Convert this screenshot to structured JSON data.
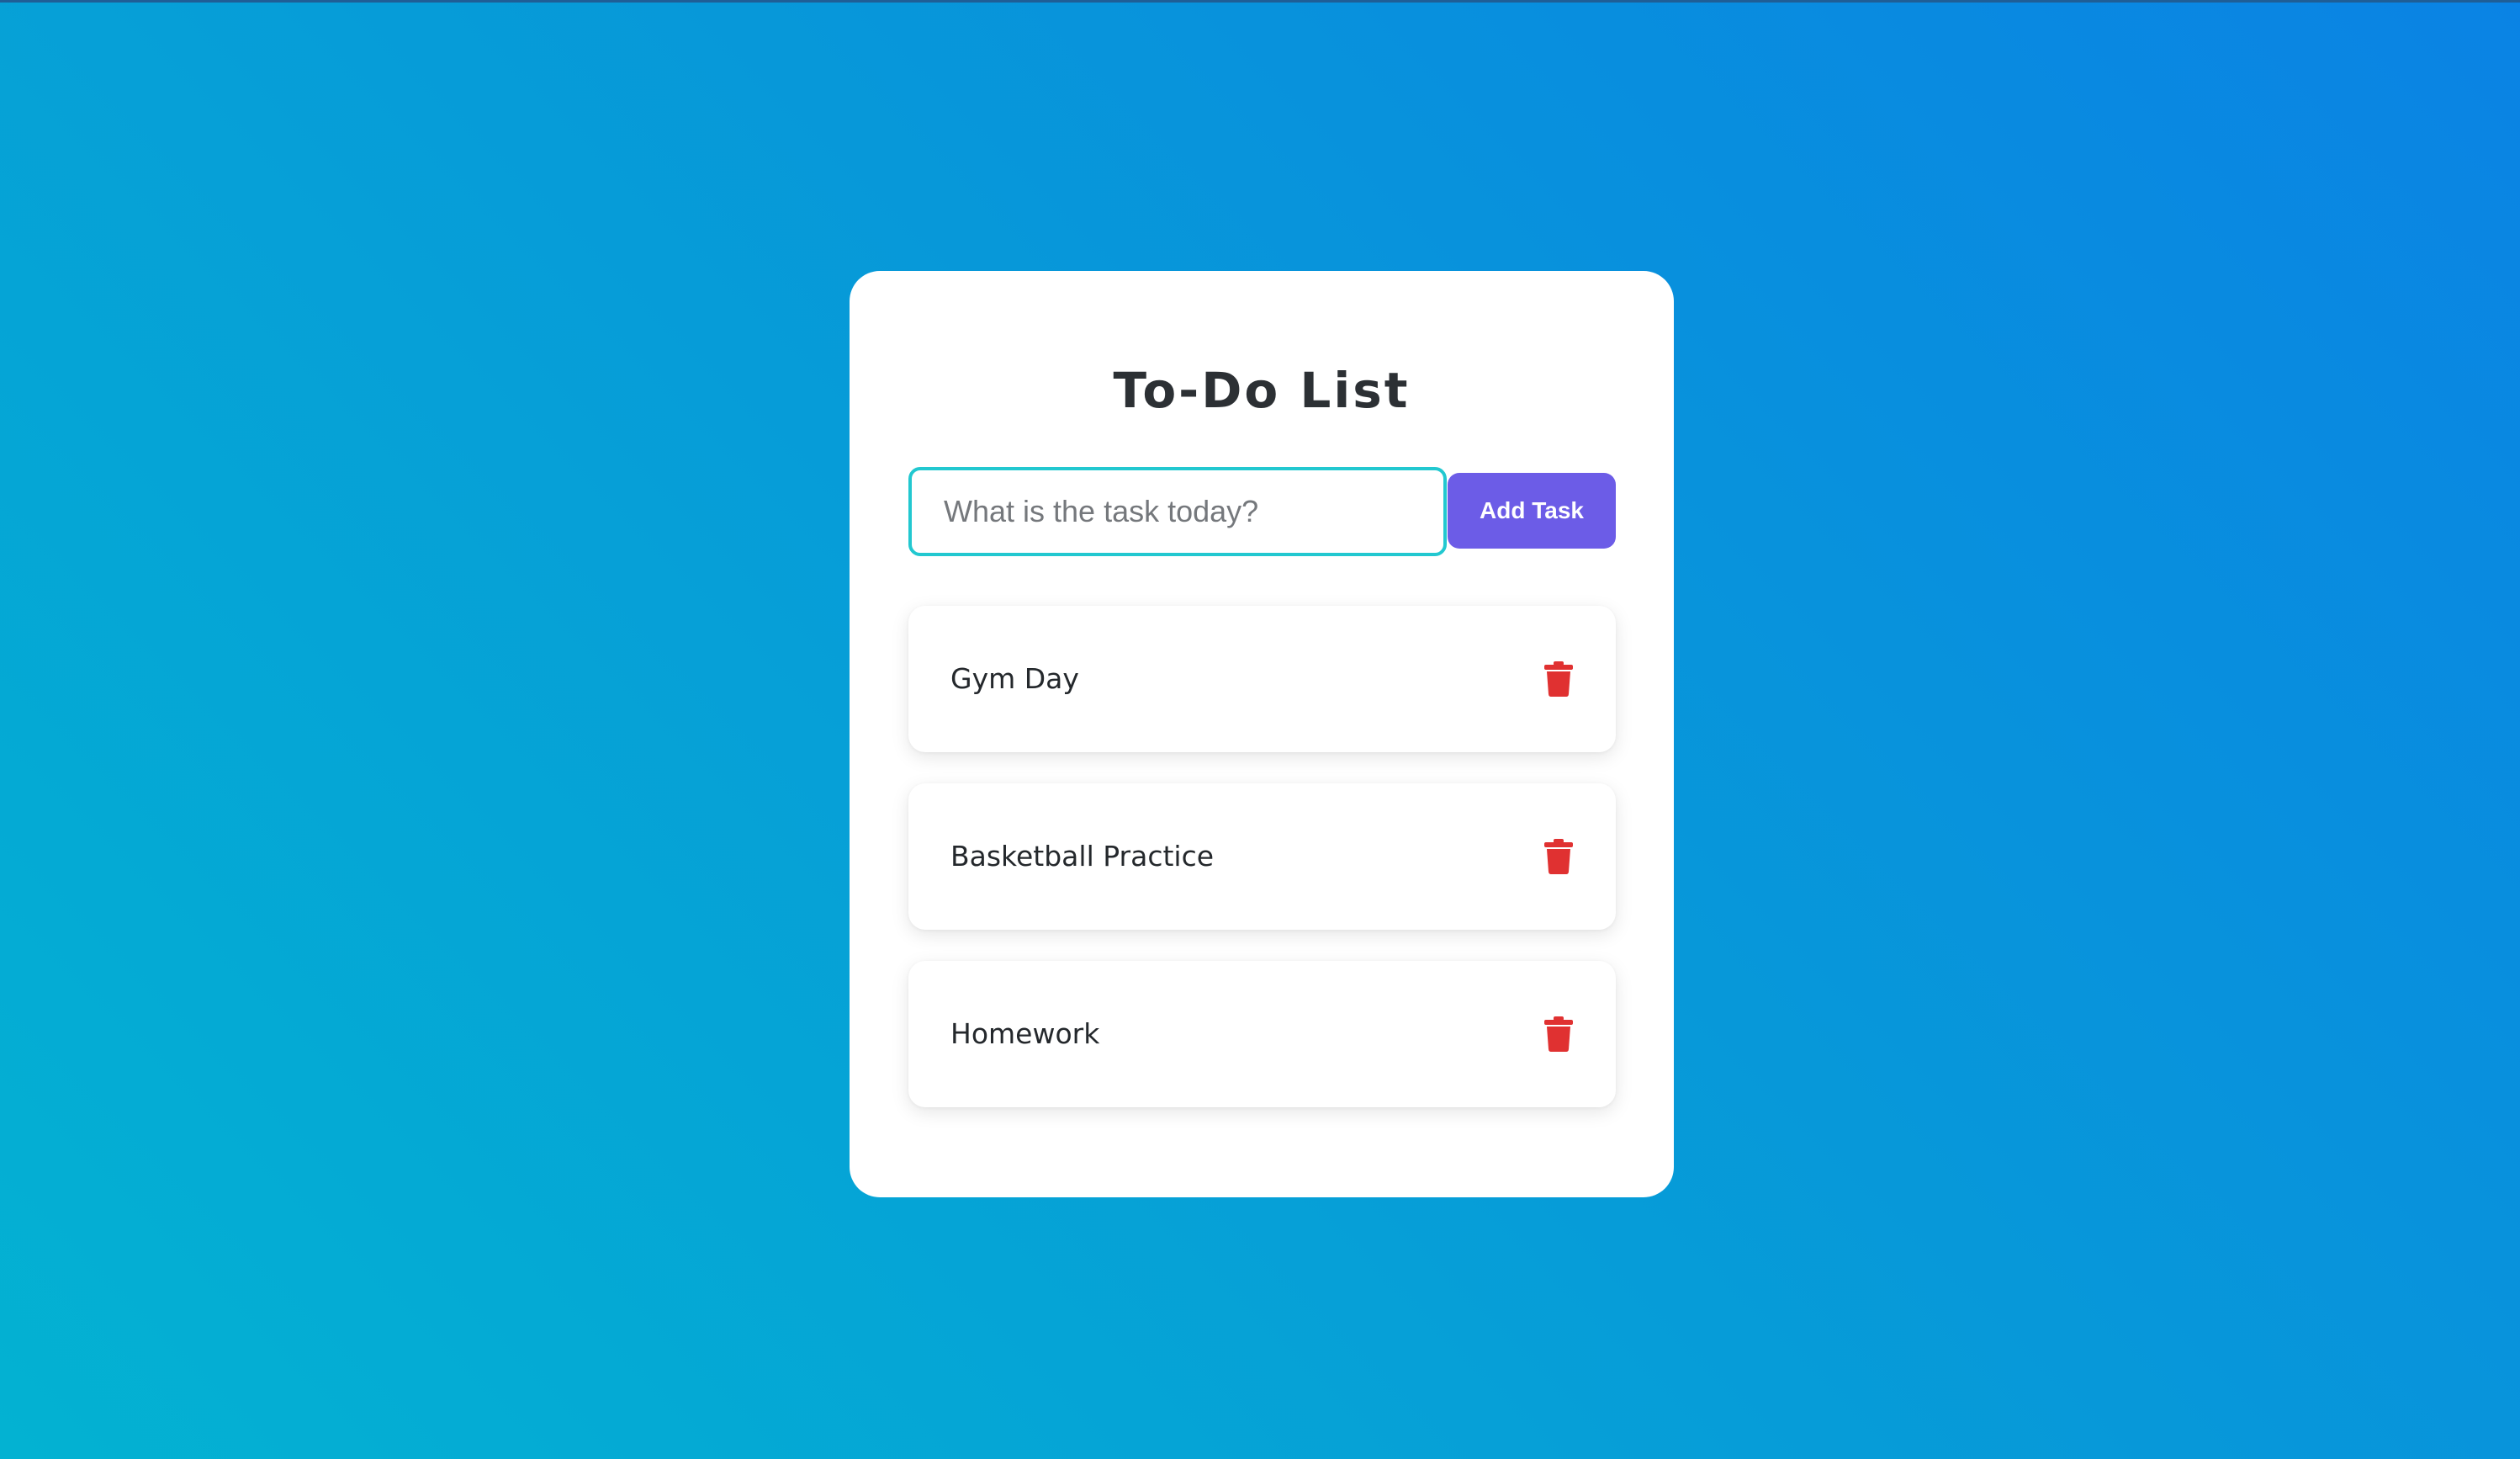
{
  "app": {
    "title": "To-Do List"
  },
  "input": {
    "placeholder": "What is the task today?",
    "value": ""
  },
  "add_button": {
    "label": "Add Task"
  },
  "tasks": [
    {
      "label": "Gym Day",
      "action_icon": "trash-icon"
    },
    {
      "label": "Basketball Practice",
      "action_icon": "trash-icon"
    },
    {
      "label": "Homework",
      "action_icon": "trash-icon"
    }
  ],
  "colors": {
    "background_gradient_start": "#0a83e4",
    "background_gradient_end": "#03b2d2",
    "card": "#ffffff",
    "title_text": "#2c3034",
    "input_border_focus": "#22c8d0",
    "accent_button": "#6c5ce7",
    "delete_icon": "#e03131"
  }
}
